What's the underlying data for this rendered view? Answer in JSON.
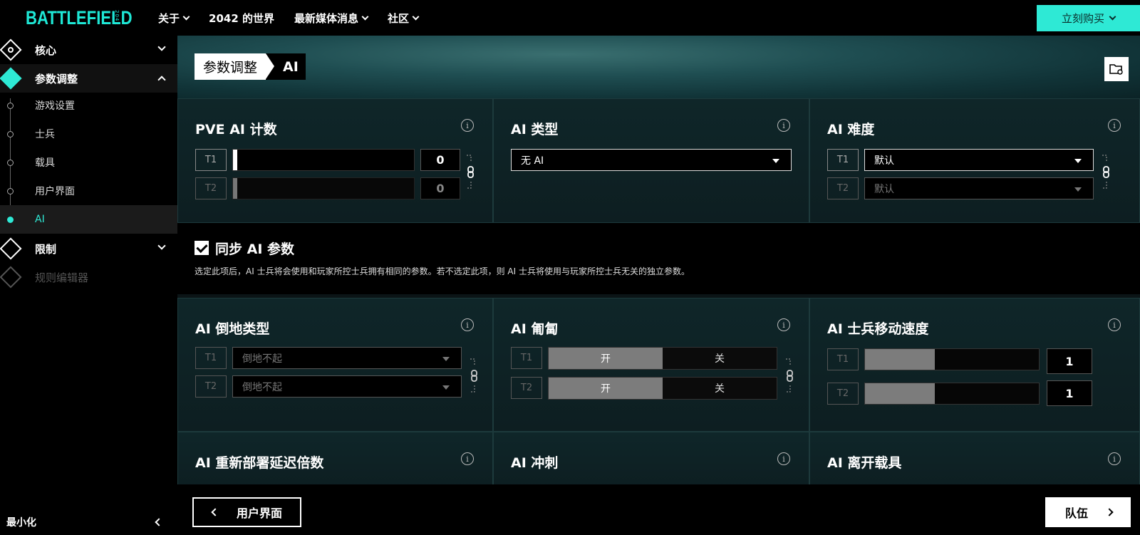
{
  "header": {
    "logo": "BATTLEFIELD",
    "logo_sub": "2042",
    "nav": [
      {
        "label": "关于"
      },
      {
        "label": "2042 的世界"
      },
      {
        "label": "最新媒体消息"
      },
      {
        "label": "社区"
      }
    ],
    "buy_label": "立刻购买"
  },
  "sidebar": {
    "sections": [
      {
        "label": "核心"
      },
      {
        "label": "参数调整"
      },
      {
        "label": "限制"
      },
      {
        "label": "规则编辑器"
      }
    ],
    "sub_items": [
      {
        "label": "游戏设置"
      },
      {
        "label": "士兵"
      },
      {
        "label": "载具"
      },
      {
        "label": "用户界面"
      },
      {
        "label": "AI"
      }
    ],
    "minimize_label": "最小化"
  },
  "breadcrumb": {
    "parent": "参数调整",
    "current": "AI"
  },
  "cards": {
    "pve_count": {
      "title": "PVE AI 计数",
      "t1": "T1",
      "t2": "T2",
      "t1_value": "0",
      "t2_value": "0"
    },
    "ai_type": {
      "title": "AI 类型",
      "value": "无 AI"
    },
    "ai_difficulty": {
      "title": "AI 难度",
      "t1": "T1",
      "t2": "T2",
      "t1_value": "默认",
      "t2_value": "默认"
    },
    "ai_down_type": {
      "title": "AI 倒地类型",
      "t1": "T1",
      "t2": "T2",
      "t1_value": "倒地不起",
      "t2_value": "倒地不起"
    },
    "ai_crawl": {
      "title": "AI 匍匐",
      "t1": "T1",
      "t2": "T2",
      "on": "开",
      "off": "关"
    },
    "ai_move_speed": {
      "title": "AI 士兵移动速度",
      "t1": "T1",
      "t2": "T2",
      "t1_value": "1",
      "t2_value": "1",
      "t1_level": 0.4,
      "t2_level": 0.4
    },
    "ai_redeploy": {
      "title": "AI 重新部署延迟倍数"
    },
    "ai_sprint": {
      "title": "AI 冲刺"
    },
    "ai_exit_vehicle": {
      "title": "AI 离开载具"
    }
  },
  "sync": {
    "title": "同步 AI 参数",
    "description": "选定此项后，AI 士兵将会使用和玩家所控士兵拥有相同的参数。若不选定此项，则 AI 士兵将使用与玩家所控士兵无关的独立参数。",
    "checked": true
  },
  "footer": {
    "back_label": "用户界面",
    "next_label": "队伍"
  },
  "colors": {
    "accent": "#2ee9d5",
    "background": "#000000"
  }
}
